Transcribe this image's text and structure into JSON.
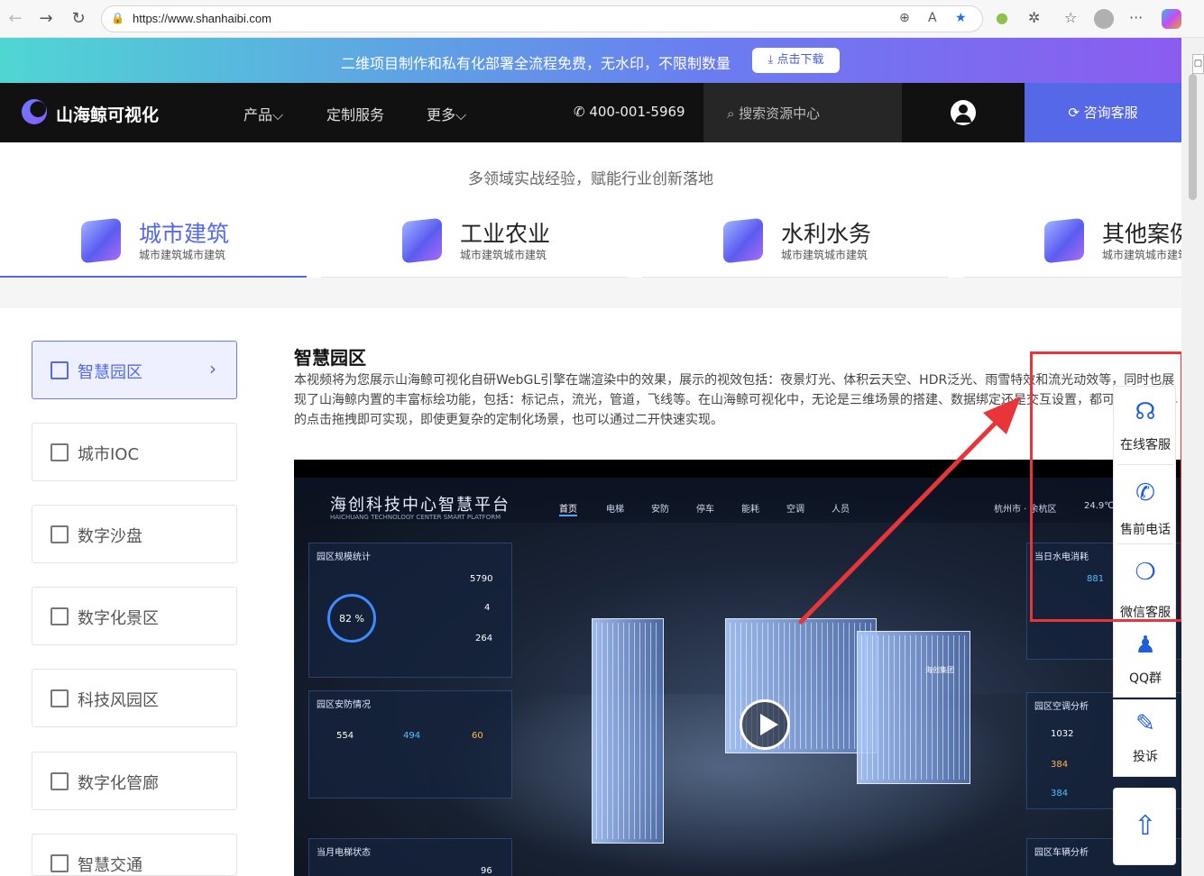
{
  "browser": {
    "url": "https://www.shanhaibi.com"
  },
  "promo": {
    "text": "二维项目制作和私有化部署全流程免费，无水印，不限制数量",
    "download_label": "点击下载"
  },
  "topnav": {
    "brand": "山海鲸可视化",
    "items": [
      {
        "label": "产品⌵"
      },
      {
        "label": "定制服务"
      },
      {
        "label": "更多⌵"
      }
    ],
    "phone": "400-001-5969",
    "search_placeholder": "搜索资源中心",
    "consult_label": "咨询客服"
  },
  "section": {
    "subtitle": "多领域实战经验，赋能行业创新落地",
    "categories": [
      {
        "title": "城市建筑",
        "sub": "城市建筑城市建筑"
      },
      {
        "title": "工业农业",
        "sub": "城市建筑城市建筑"
      },
      {
        "title": "水利水务",
        "sub": "城市建筑城市建筑"
      },
      {
        "title": "其他案例",
        "sub": "城市建筑城市建筑"
      }
    ]
  },
  "sidebar": {
    "items": [
      {
        "label": "智慧园区"
      },
      {
        "label": "城市IOC"
      },
      {
        "label": "数字沙盘"
      },
      {
        "label": "数字化景区"
      },
      {
        "label": "科技风园区"
      },
      {
        "label": "数字化管廊"
      },
      {
        "label": "智慧交通"
      }
    ]
  },
  "main": {
    "title": "智慧园区",
    "description": "本视频将为您展示山海鲸可视化自研WebGL引擎在端渲染中的效果，展示的视效包括：夜景灯光、体积云天空、HDR泛光、雨雪特效和流光动效等，同时也展现了山海鲸内置的丰富标绘功能，包括：标记点，流光，管道，飞线等。在山海鲸可视化中，无论是三维场景的搭建、数据绑定还是交互设置，都可以通过简单的点击拖拽即可实现，即使更复杂的定制化场景，也可以通过二开快速实现。"
  },
  "video": {
    "title": "海创科技中心智慧平台",
    "subtitle": "HAICHUANG TECHNOLOGY CENTER SMART PLATFORM",
    "nav": [
      "首页",
      "电梯",
      "安防",
      "停车",
      "能耗",
      "空调",
      "人员"
    ],
    "location": "杭州市 · 余杭区",
    "temperature": "24.9℃",
    "panel1_title": "园区规模统计",
    "stat_ring": "82 %",
    "stat_area": "5790",
    "stat_buildings": "4",
    "stat_offices": "264",
    "panel2_title": "园区安防情况",
    "monitor_total": "554",
    "monitor_normal": "494",
    "monitor_fault": "60",
    "panel3_title": "当月电梯状态",
    "elevator_value": "96",
    "right1_title": "当日水电消耗",
    "right1_value": "881",
    "right2_title": "园区空调分析",
    "ac_total": "1032",
    "ac_on": "384",
    "ac_off": "384",
    "right3_title": "园区车辆分析",
    "building_label": "海创集团"
  },
  "service": {
    "online": "在线客服",
    "presale": "售前电话",
    "wechat": "微信客服",
    "qq": "QQ群",
    "complaint": "投诉"
  },
  "colors": {
    "accent": "#5468e8",
    "highlight": "#e8353a",
    "service_icon": "#1f5fd6"
  }
}
